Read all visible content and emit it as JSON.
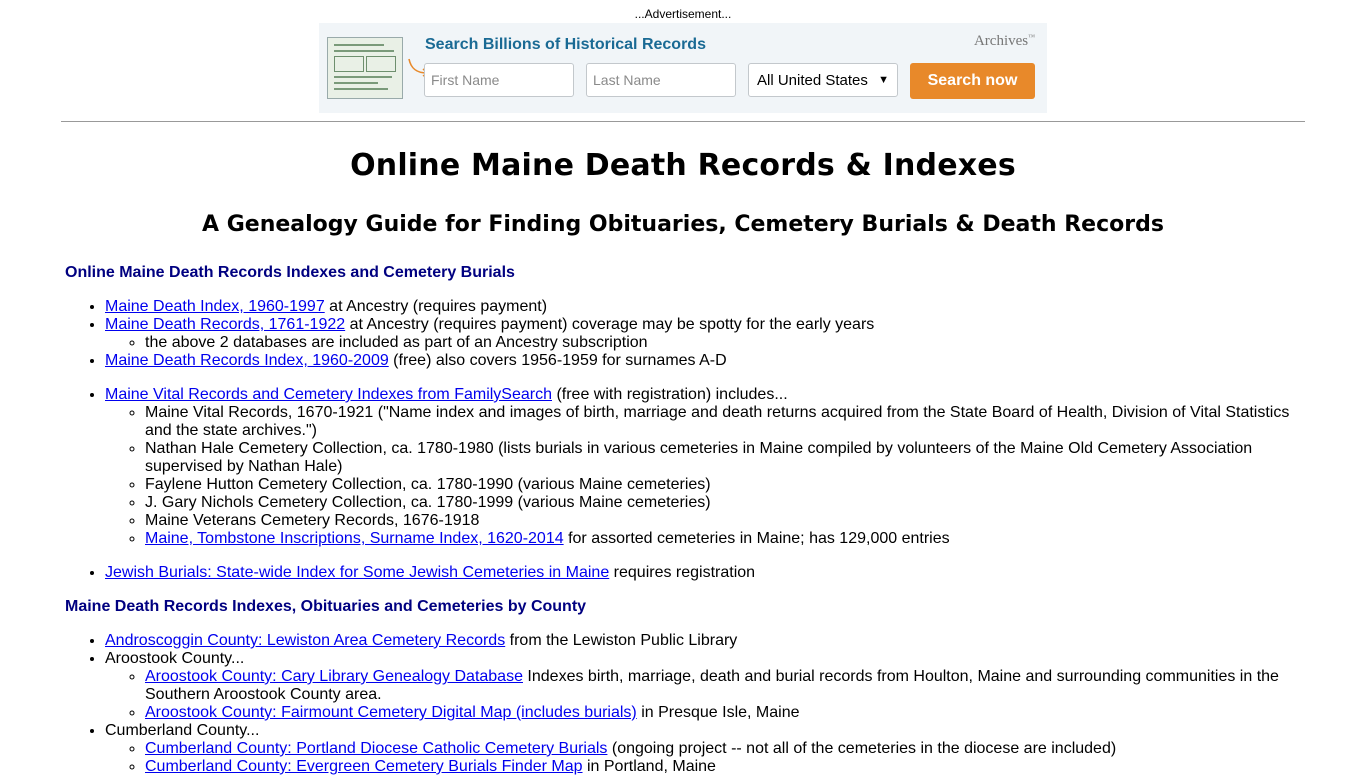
{
  "ad": {
    "label": "...Advertisement...",
    "title": "Search Billions of Historical Records",
    "brand": "Archives",
    "brand_mark": "™",
    "first_name_placeholder": "First Name",
    "last_name_placeholder": "Last Name",
    "location_selected": "All United States",
    "search_button": "Search now",
    "accent_color": "#e8892a",
    "title_color": "#1a6a94"
  },
  "page": {
    "title": "Online Maine Death Records & Indexes",
    "subtitle": "A Genealogy Guide for Finding Obituaries, Cemetery Burials & Death Records"
  },
  "section1": {
    "heading": "Online Maine Death Records Indexes and Cemetery Burials",
    "group1": [
      {
        "link": "Maine Death Index, 1960-1997",
        "text": " at Ancestry (requires payment)"
      },
      {
        "link": "Maine Death Records, 1761-1922",
        "text": " at Ancestry (requires payment) coverage may be spotty for the early years",
        "sub": [
          "the above 2 databases are included as part of an Ancestry subscription"
        ]
      },
      {
        "link": "Maine Death Records Index, 1960-2009",
        "text": " (free) also covers 1956-1959 for surnames A-D"
      }
    ],
    "group2": {
      "link": "Maine Vital Records and Cemetery Indexes from FamilySearch",
      "text": " (free with registration) includes...",
      "sub": [
        "Maine Vital Records, 1670-1921 (\"Name index and images of birth, marriage and death returns acquired from the State Board of Health, Division of Vital Statistics and the state archives.\")",
        "Nathan Hale Cemetery Collection, ca. 1780-1980 (lists burials in various cemeteries in Maine compiled by volunteers of the Maine Old Cemetery Association supervised by Nathan Hale)",
        "Faylene Hutton Cemetery Collection, ca. 1780-1990 (various Maine cemeteries)",
        "J. Gary Nichols Cemetery Collection, ca. 1780-1999 (various Maine cemeteries)",
        "Maine Veterans Cemetery Records, 1676-1918"
      ],
      "sub_link": "Maine, Tombstone Inscriptions, Surname Index, 1620-2014",
      "sub_link_text": " for assorted cemeteries in Maine; has 129,000 entries"
    },
    "group3": {
      "link": "Jewish Burials: State-wide Index for Some Jewish Cemeteries in Maine",
      "text": " requires registration"
    }
  },
  "section2": {
    "heading": "Maine Death Records Indexes, Obituaries and Cemeteries by County",
    "androscoggin": {
      "link": "Androscoggin County: Lewiston Area Cemetery Records",
      "text": " from the Lewiston Public Library"
    },
    "aroostook": {
      "label": "Aroostook County...",
      "items": [
        {
          "link": "Aroostook County: Cary Library Genealogy Database",
          "text": " Indexes birth, marriage, death and burial records from Houlton, Maine and surrounding communities in the Southern Aroostook County area."
        },
        {
          "link": "Aroostook County: Fairmount Cemetery Digital Map (includes burials)",
          "text": " in Presque Isle, Maine"
        }
      ]
    },
    "cumberland": {
      "label": "Cumberland County...",
      "items": [
        {
          "link": "Cumberland County: Portland Diocese Catholic Cemetery Burials",
          "text": " (ongoing project -- not all of the cemeteries in the diocese are included)"
        },
        {
          "link": "Cumberland County: Evergreen Cemetery Burials Finder Map",
          "text": " in Portland, Maine"
        }
      ]
    }
  }
}
